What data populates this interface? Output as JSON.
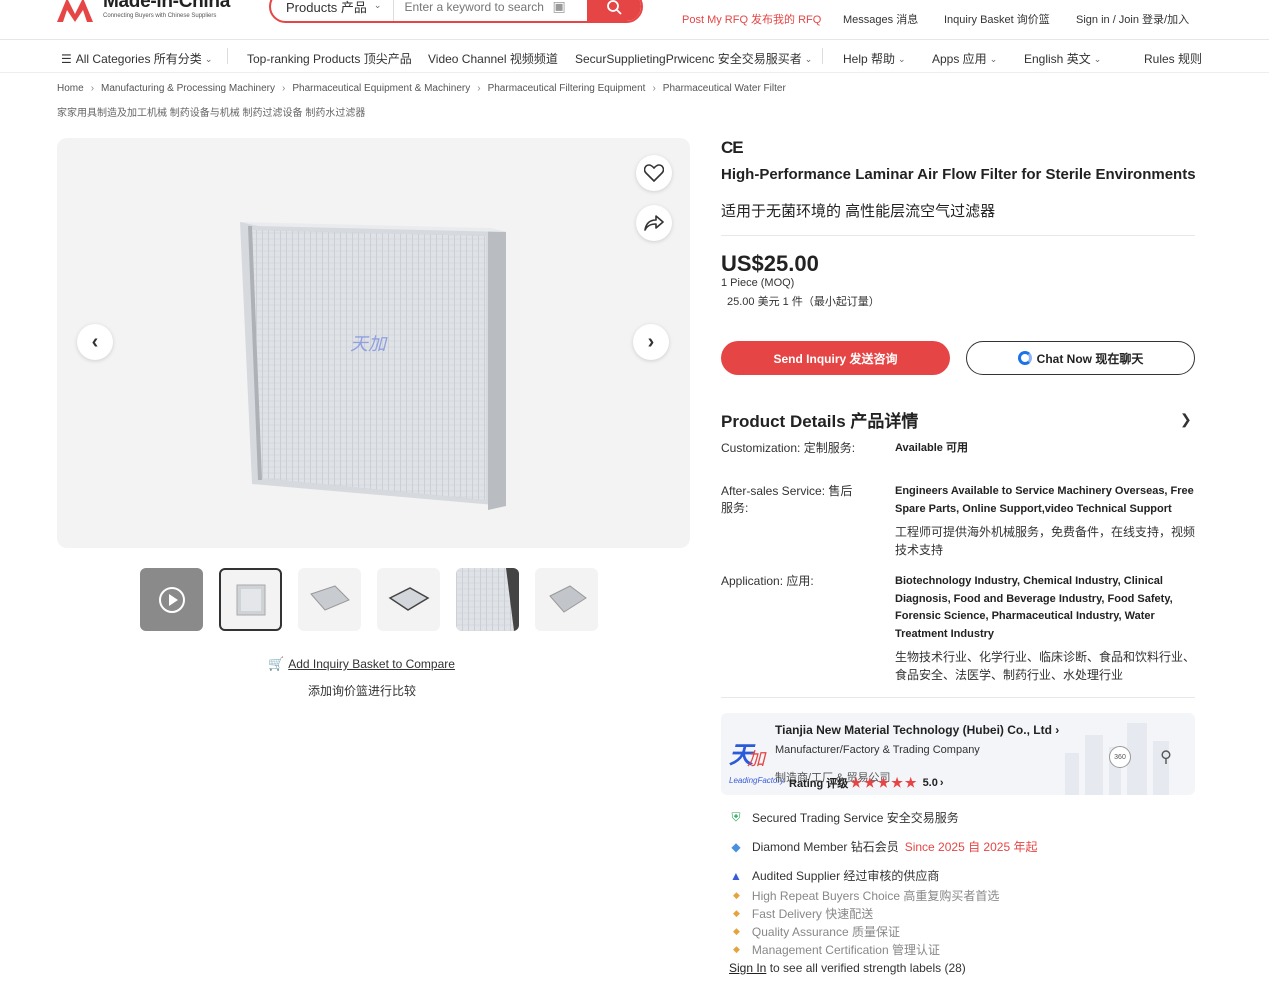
{
  "header": {
    "logo_name": "Made-in-China",
    "logo_tagline": "Connecting Buyers with Chinese Suppliers",
    "search_category": "Products 产品",
    "search_placeholder": "Enter a keyword to search pr...",
    "post_rfq": "Post My RFQ 发布我的 RFQ",
    "messages": "Messages 消息",
    "inquiry_basket": "Inquiry Basket 询价篮",
    "sign_in": "Sign in / Join 登录/加入"
  },
  "nav": {
    "all_categories": "All Categories 所有分类",
    "top_ranking": "Top-ranking Products 顶尖产品",
    "video_channel": "Video Channel 视频频道",
    "overlap_text": "SecurSupplietingPrwicenc 安全交易服买者",
    "help": "Help 帮助",
    "apps": "Apps 应用",
    "language": "English 英文",
    "rules": "Rules 规则"
  },
  "breadcrumb": {
    "items": [
      "Home",
      "Manufacturing & Processing Machinery",
      "Pharmaceutical Equipment & Machinery",
      "Pharmaceutical Filtering Equipment",
      "Pharmaceutical Water Filter"
    ],
    "cn": "家家用具制造及加工机械 制药设备与机械 制药过滤设备 制药水过滤器"
  },
  "gallery": {
    "add_basket": "Add Inquiry Basket to Compare",
    "add_basket_cn": "添加询价篮进行比较",
    "thumb_count": 6,
    "active_thumb": 2
  },
  "product": {
    "cert": "CE",
    "title": "High-Performance Laminar Air Flow Filter for Sterile Environments",
    "title_cn": "适用于无菌环境的 高性能层流空气过滤器",
    "price": "US$25.00",
    "moq": "1 Piece (MOQ)",
    "moq_cn": "25.00 美元 1 件（最小起订量）",
    "send_inquiry": "Send Inquiry 发送咨询",
    "chat_now": "Chat Now 现在聊天"
  },
  "details": {
    "title": "Product Details 产品详情",
    "specs": [
      {
        "label": "Customization: 定制服务:",
        "value": "Available 可用",
        "value_cn": ""
      },
      {
        "label": "After-sales Service: 售后服务:",
        "value": "Engineers Available to Service Machinery Overseas, Free Spare Parts, Online Support,video Technical Support",
        "value_cn": "工程师可提供海外机械服务，免费备件，在线支持，视频技术支持"
      },
      {
        "label": "Application: 应用:",
        "value": "Biotechnology Industry, Chemical Industry, Clinical Diagnosis, Food and Beverage Industry, Food Safety, Forensic Science, Pharmaceutical Industry, Water Treatment Industry",
        "value_cn": "生物技术行业、化学行业、临床诊断、食品和饮料行业、食品安全、法医学、制药行业、水处理行业"
      }
    ]
  },
  "supplier": {
    "name": "Tianjia New Material Technology (Hubei) Co., Ltd",
    "type": "Manufacturer/Factory & Trading Company",
    "type_cn": "制造商/工厂 & 贸易公司",
    "rating_label": "Rating 评级",
    "rating": "5.0",
    "badge": "LeadingFactory",
    "view_360": "360"
  },
  "services": {
    "secured": "Secured Trading Service 安全交易服务",
    "diamond": "Diamond Member 钻石会员",
    "since": "Since 2025 自 2025 年起",
    "audited": "Audited Supplier 经过审核的供应商",
    "sub": [
      "High Repeat Buyers Choice 高重复购买者首选",
      "Fast Delivery 快速配送",
      "Quality Assurance 质量保证",
      "Management Certification 管理认证"
    ],
    "sign_in_link": "Sign In",
    "sign_in_rest": "to see all verified strength labels (28)"
  },
  "colors": {
    "brand_red": "#e64545",
    "link_blue": "#1a73e8",
    "since_red": "#e64545"
  }
}
